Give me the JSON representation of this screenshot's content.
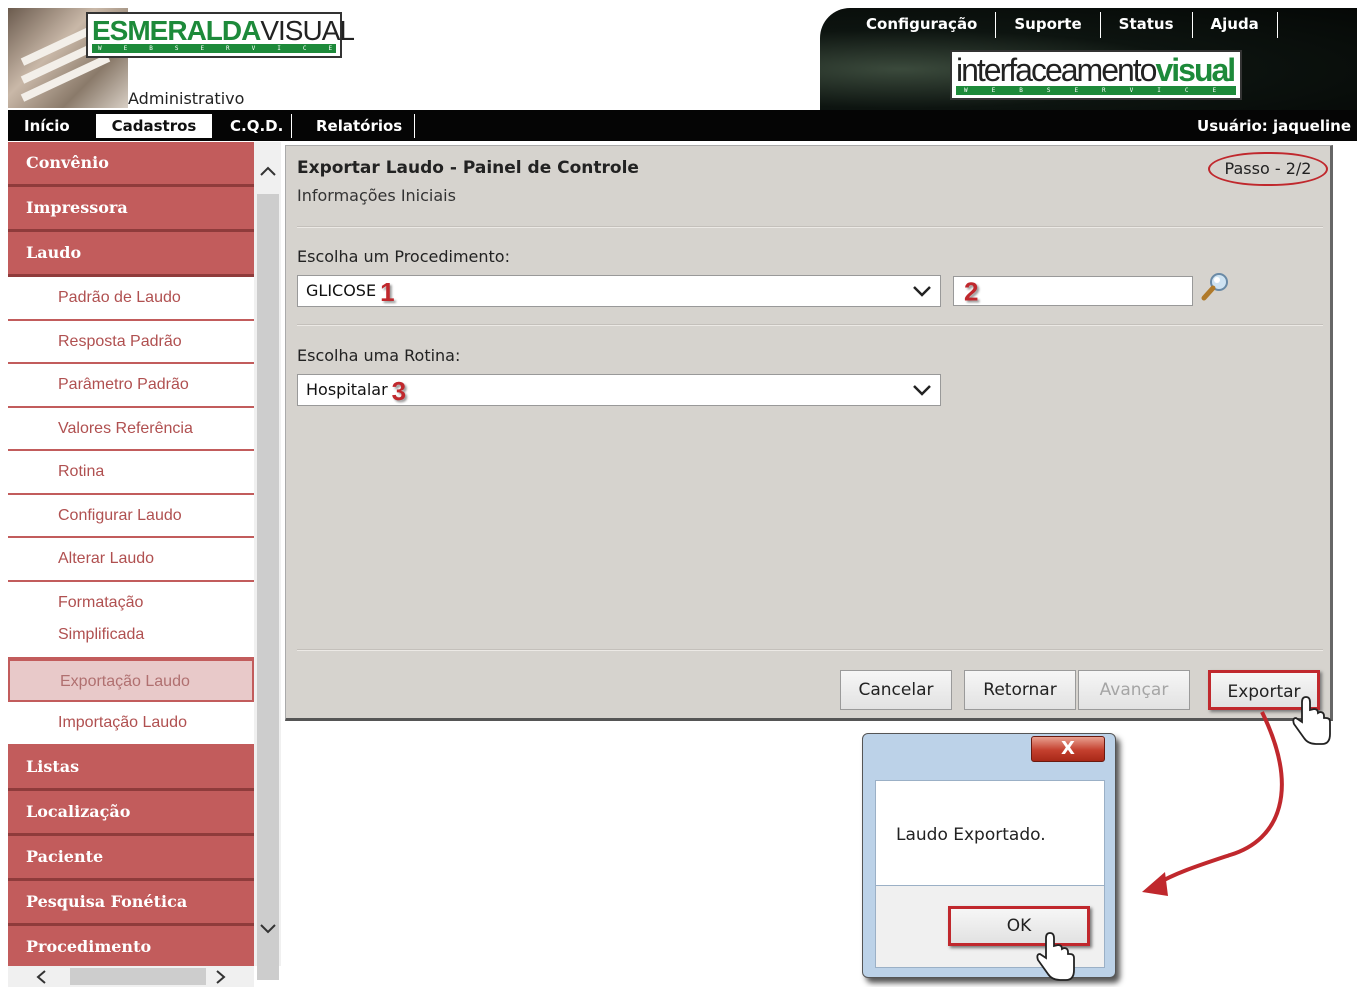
{
  "header": {
    "brand_green": "ESMERALDA",
    "brand_dark": "VISUAL",
    "brand_sub": "WEBSERVICE",
    "section": "Administrativo",
    "top_links": [
      "Configuração",
      "Suporte",
      "Status",
      "Ajuda"
    ],
    "partner_logo_thin": "interfaceamento",
    "partner_logo_bold": "visual",
    "partner_sub": "WEBSERVICE"
  },
  "nav": {
    "tabs": [
      "Início",
      "Cadastros",
      "C.Q.D.",
      "Relatórios"
    ],
    "active": "Cadastros",
    "user": "Usuário: jaqueline"
  },
  "sidebar": {
    "top_categories": [
      "Convênio",
      "Impressora",
      "Laudo"
    ],
    "laudo_items": [
      "Padrão de Laudo",
      "Resposta Padrão",
      "Parâmetro Padrão",
      "Valores Referência",
      "Rotina",
      "Configurar Laudo",
      "Alterar Laudo",
      "Formatação Simplificada",
      "Exportação Laudo",
      "Importação Laudo"
    ],
    "active_item": "Exportação Laudo",
    "bottom_categories": [
      "Listas",
      "Localização",
      "Paciente",
      "Pesquisa Fonética",
      "Procedimento"
    ]
  },
  "panel": {
    "title": "Exportar Laudo - Painel de Controle",
    "subtitle": "Informações Iniciais",
    "step": "Passo - 2/2",
    "procedure_label": "Escolha um Procedimento:",
    "procedure_value": "GLICOSE",
    "procedure_code": "",
    "routine_label": "Escolha uma Rotina:",
    "routine_value": "Hospitalar",
    "markers": [
      "1",
      "2",
      "3"
    ],
    "buttons": {
      "cancel": "Cancelar",
      "back": "Retornar",
      "next": "Avançar",
      "export": "Exportar"
    }
  },
  "dialog": {
    "close_glyph": "X",
    "message": "Laudo Exportado.",
    "ok": "OK"
  },
  "colors": {
    "accent_red": "#c0282d",
    "sidebar_category": "#c25c5c",
    "brand_green": "#1d8a3a",
    "panel_bg": "#d6d3ce"
  }
}
